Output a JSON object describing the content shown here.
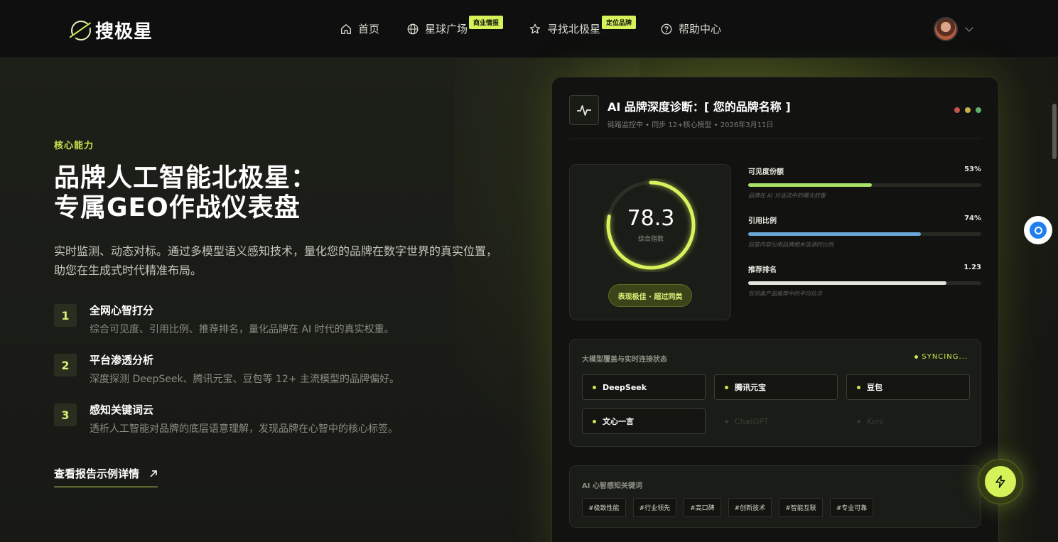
{
  "header": {
    "logo_text": "搜极星",
    "nav": [
      {
        "label": "首页",
        "icon": "home-icon"
      },
      {
        "label": "星球广场",
        "icon": "globe-icon",
        "badge": "商业情报"
      },
      {
        "label": "寻找北极星",
        "icon": "star-icon",
        "badge": "定位品牌"
      },
      {
        "label": "帮助中心",
        "icon": "help-circle-icon"
      }
    ]
  },
  "hero": {
    "eyebrow": "核心能力",
    "title_line1": "品牌人工智能北极星：",
    "title_line2": "专属GEO作战仪表盘",
    "description": "实时监测、动态对标。通过多模型语义感知技术，量化您的品牌在数字世界的真实位置，助您在生成式时代精准布局。",
    "features": [
      {
        "num": "1",
        "title": "全网心智打分",
        "desc": "综合可见度、引用比例、推荐排名，量化品牌在 AI 时代的真实权重。"
      },
      {
        "num": "2",
        "title": "平台渗透分析",
        "desc": "深度探测 DeepSeek、腾讯元宝、豆包等 12+ 主流模型的品牌偏好。"
      },
      {
        "num": "3",
        "title": "感知关键词云",
        "desc": "透析人工智能对品牌的底层语意理解，发现品牌在心智中的核心标签。"
      }
    ],
    "report_link": "查看报告示例详情"
  },
  "dashboard": {
    "title": "AI 品牌深度诊断：[ 您的品牌名称 ]",
    "subtitle": "链路监控中 • 同步 12+核心模型 • 2026年3月11日",
    "window_dots": [
      "#c9524d",
      "#c9b24d",
      "#5fae6b"
    ],
    "score": {
      "value": "78.3",
      "label": "综合指数",
      "fraction": 0.783,
      "pill": "表现极佳 · 超过同类"
    },
    "metrics": [
      {
        "name": "可见度份额",
        "value": "53%",
        "fraction": 0.53,
        "color": "#a9e06a",
        "note": "品牌在 AI 对话流中的曝光权重"
      },
      {
        "name": "引用比例",
        "value": "74%",
        "fraction": 0.74,
        "color": "#6aa7d6",
        "note": "回答内容引用品牌相关信源的比例"
      },
      {
        "name": "推荐排名",
        "value": "1.23",
        "fraction": 0.85,
        "color": "#e3e5dc",
        "note": "在同类产品推荐中的平均位次"
      }
    ],
    "models": {
      "title": "大模型覆盖与实时连接状态",
      "status": "SYNCING...",
      "items": [
        {
          "name": "DeepSeek",
          "active": true
        },
        {
          "name": "腾讯元宝",
          "active": true
        },
        {
          "name": "豆包",
          "active": true
        },
        {
          "name": "文心一言",
          "active": true
        },
        {
          "name": "ChatGPT",
          "active": false
        },
        {
          "name": "Kimi",
          "active": false
        }
      ]
    },
    "keywords": {
      "title": "AI 心智感知关键词",
      "tags": [
        "#极致性能",
        "#行业领先",
        "#高口碑",
        "#创新技术",
        "#智能互联",
        "#专业可靠"
      ]
    }
  },
  "colors": {
    "accent": "#c6e64f",
    "background": "#161713",
    "card": "#121311"
  }
}
